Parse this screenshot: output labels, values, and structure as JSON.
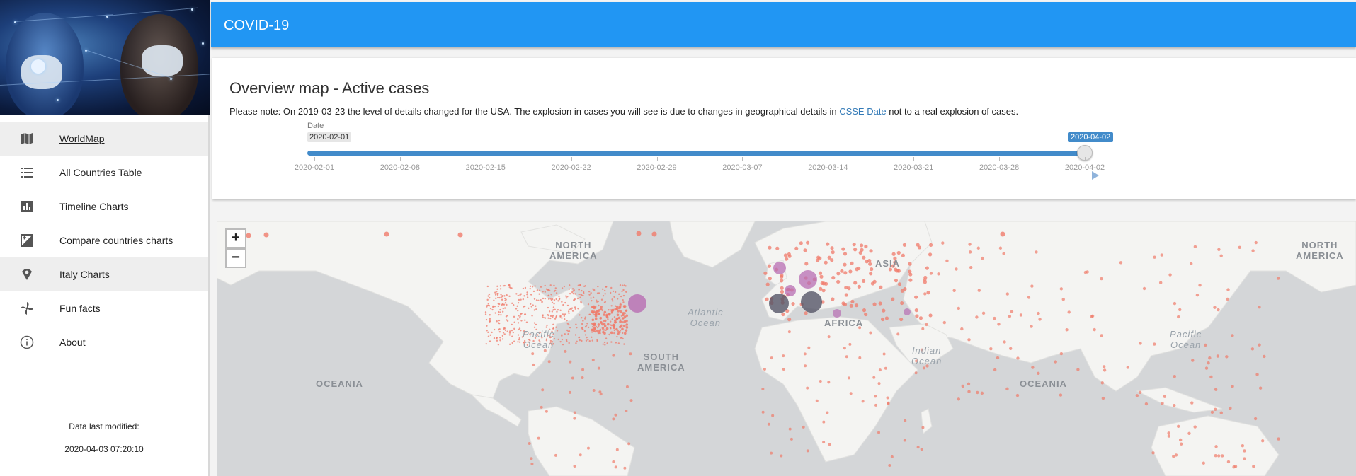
{
  "app": {
    "title": "COVID-19"
  },
  "sidebar": {
    "items": [
      {
        "label": "WorldMap",
        "icon": "map-icon",
        "active": true
      },
      {
        "label": "All Countries Table",
        "icon": "list-icon",
        "active": false
      },
      {
        "label": "Timeline Charts",
        "icon": "bar-chart-icon",
        "active": false
      },
      {
        "label": "Compare countries charts",
        "icon": "compare-chart-icon",
        "active": false
      },
      {
        "label": "Italy Charts",
        "icon": "italy-pin-icon",
        "active": true
      },
      {
        "label": "Fun facts",
        "icon": "pinwheel-icon",
        "active": false
      },
      {
        "label": "About",
        "icon": "info-icon",
        "active": false
      }
    ],
    "modified_label": "Data last modified:",
    "modified_value": "2020-04-03 07:20:10"
  },
  "panel": {
    "title": "Overview map - Active cases",
    "note_before": "Please note: On 2019-03-23 the level of details changed for the USA. The explosion in cases you will see is due to changes in geographical details in ",
    "note_link": "CSSE Date",
    "note_after": " not to a real explosion of cases."
  },
  "slider": {
    "label": "Date",
    "min": "2020-02-01",
    "max": "2020-04-02",
    "value": "2020-04-02",
    "position": 1.0,
    "ticks": [
      "2020-02-01",
      "2020-02-08",
      "2020-02-15",
      "2020-02-22",
      "2020-02-29",
      "2020-03-07",
      "2020-03-14",
      "2020-03-21",
      "2020-03-28",
      "2020-04-02"
    ]
  },
  "map": {
    "zoom_in": "+",
    "zoom_out": "−",
    "labels": [
      "NORTH AMERICA",
      "ASIA",
      "NORTH AMERICA",
      "AFRICA",
      "SOUTH AMERICA",
      "OCEANIA",
      "OCEANIA"
    ],
    "oceans": [
      "Atlantic Ocean",
      "Pacific Ocean",
      "Indian Ocean",
      "Pacific Ocean"
    ],
    "colors": {
      "land": "#f4f4f2",
      "water": "#d4d6d8",
      "small_case": "#f07a6a",
      "medium_case": "#b86db3",
      "large_case": "#555566",
      "accent": "#2196f3"
    }
  }
}
